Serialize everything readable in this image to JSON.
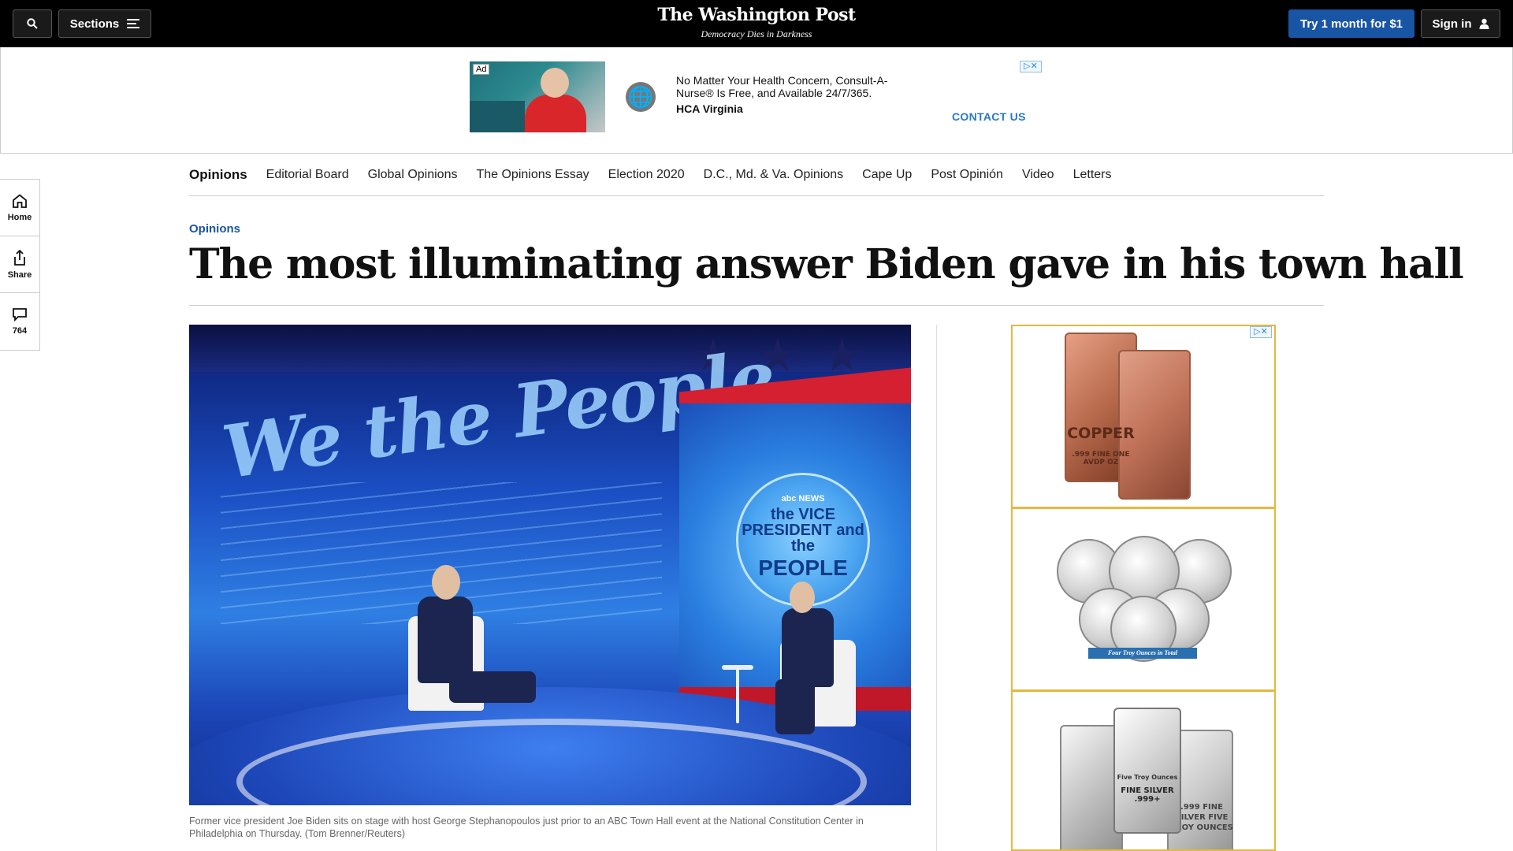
{
  "topbar": {
    "sections_label": "Sections",
    "logo": "The Washington Post",
    "tagline": "Democracy Dies in Darkness",
    "subscribe_label": "Try 1 month for $1",
    "signin_label": "Sign in"
  },
  "top_ad": {
    "ad_label": "Ad",
    "text": "No Matter Your Health Concern, Consult-A-Nurse® Is Free, and Available 24/7/365.",
    "advertiser": "HCA Virginia",
    "cta": "CONTACT US",
    "adchoices": "▷✕"
  },
  "rail": {
    "home_label": "Home",
    "share_label": "Share",
    "comments_count": "764"
  },
  "section_nav": {
    "items": [
      "Opinions",
      "Editorial Board",
      "Global Opinions",
      "The Opinions Essay",
      "Election 2020",
      "D.C., Md. & Va. Opinions",
      "Cape Up",
      "Post Opinión",
      "Video",
      "Letters"
    ]
  },
  "article": {
    "kicker": "Opinions",
    "headline": "The most illuminating answer Biden gave in his town hall",
    "caption": "Former vice president Joe Biden sits on stage with host George Stephanopoulos just prior to an ABC Town Hall event at the National Constitution Center in Philadelphia on Thursday. (Tom Brenner/Reuters)"
  },
  "hero_image": {
    "backdrop_text": "We the People",
    "seal_line1": "abc NEWS",
    "seal_line2": "the VICE PRESIDENT and the",
    "seal_line3": "PEOPLE"
  },
  "side_ad": {
    "adchoices": "▷✕",
    "bar1_text": "COPPER",
    "bar1_sub": ".999 FINE ONE AVDP OZ",
    "coins_ribbon": "Four Troy Ounces in Total",
    "bar3_text": "FINE SILVER .999+",
    "bar3_sub": "Five Troy Ounces",
    "bar3_side": ".999 FINE SILVER FIVE TROY OUNCES"
  },
  "colors": {
    "topbar_bg": "#000000",
    "accent_blue": "#1955a5",
    "ad_cta": "#2a78c6",
    "side_ad_border": "#e6b840"
  },
  "icons": {
    "search": "search-icon",
    "sections": "hamburger-menu-icon",
    "signin": "user-icon",
    "home": "home-icon",
    "share": "share-icon",
    "comments": "comment-icon",
    "globe": "globe-icon"
  }
}
